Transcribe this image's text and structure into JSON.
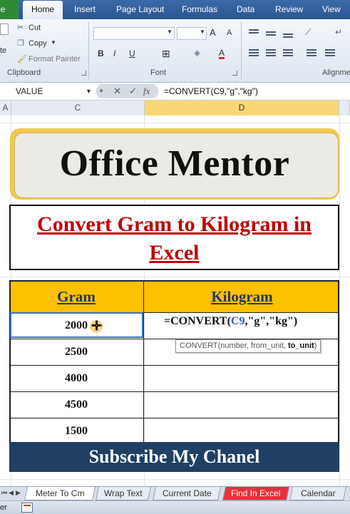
{
  "ribbon": {
    "tabs": [
      "le",
      "Home",
      "Insert",
      "Page Layout",
      "Formulas",
      "Data",
      "Review",
      "View"
    ],
    "active_tab": "Home",
    "clipboard": {
      "cut": "Cut",
      "copy": "Copy",
      "format_painter": "Format Painter",
      "paste_partial": "te",
      "label": "Clipboard"
    },
    "font_label": "Font",
    "alignment_label": "Alignme",
    "bold": "B",
    "italic": "I",
    "underline": "U",
    "grow_font": "A",
    "shrink_font": "A",
    "font_color": "A"
  },
  "formula_bar": {
    "name_box": "VALUE",
    "cancel": "✕",
    "enter": "✓",
    "fx": "fx",
    "formula": "=CONVERT(C9,\"g\",\"kg\")"
  },
  "columns": [
    "A",
    "C",
    "D"
  ],
  "sheet": {
    "banner": "Office Mentor",
    "title_line1": "Convert Gram to Kilogram in",
    "title_line2": "Excel",
    "headers": {
      "gram": "Gram",
      "kilogram": "Kilogram"
    },
    "rows": [
      {
        "gram": "2000"
      },
      {
        "gram": "2500"
      },
      {
        "gram": "4000"
      },
      {
        "gram": "4500"
      },
      {
        "gram": "1500"
      }
    ],
    "edit_prefix": "=CONVERT(",
    "edit_ref": "C9",
    "edit_suffix": ",\"g\",\"kg\")",
    "tooltip_prefix": "CONVERT(number, from_unit, ",
    "tooltip_bold": "to_unit",
    "tooltip_suffix": ")",
    "subscribe": "Subscribe My Chanel"
  },
  "sheet_tabs": [
    "Meter To Cm",
    "Wrap Text",
    "Current Date",
    "Find In Excel",
    "Calendar"
  ],
  "active_sheet_tab": "Meter To Cm",
  "status": {
    "text": "er"
  },
  "colors": {
    "banner": "#f2c94c",
    "title_red": "#c00000",
    "header": "#ffc000",
    "subscribe": "#1f3f63",
    "selected_column": "#f8d775"
  }
}
